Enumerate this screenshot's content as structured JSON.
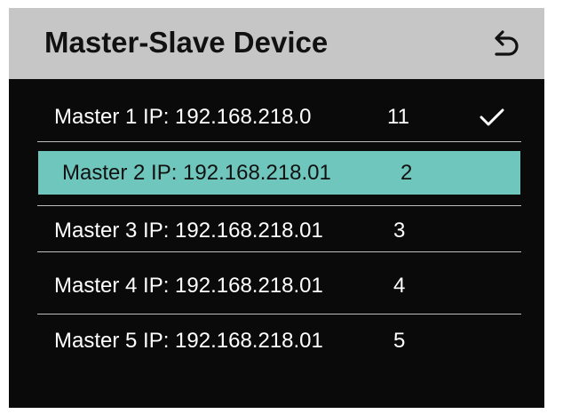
{
  "header": {
    "title": "Master-Slave Device",
    "back_icon": "back-arrow-icon"
  },
  "devices": [
    {
      "label": "Master 1 IP:  192.168.218.0",
      "number": "11",
      "checked": true,
      "selected": false
    },
    {
      "label": "Master 2 IP: 192.168.218.01",
      "number": "2",
      "checked": false,
      "selected": true
    },
    {
      "label": "Master 3 IP: 192.168.218.01",
      "number": "3",
      "checked": false,
      "selected": false
    },
    {
      "label": "Master 4 IP: 192.168.218.01",
      "number": "4",
      "checked": false,
      "selected": false
    },
    {
      "label": "Master 5 IP: 192.168.218.01",
      "number": "5",
      "checked": false,
      "selected": false
    }
  ],
  "colors": {
    "header_bg": "#c6c6c6",
    "screen_bg": "#0a0a0a",
    "selected_bg": "#6fc6bc",
    "text": "#ffffff"
  }
}
